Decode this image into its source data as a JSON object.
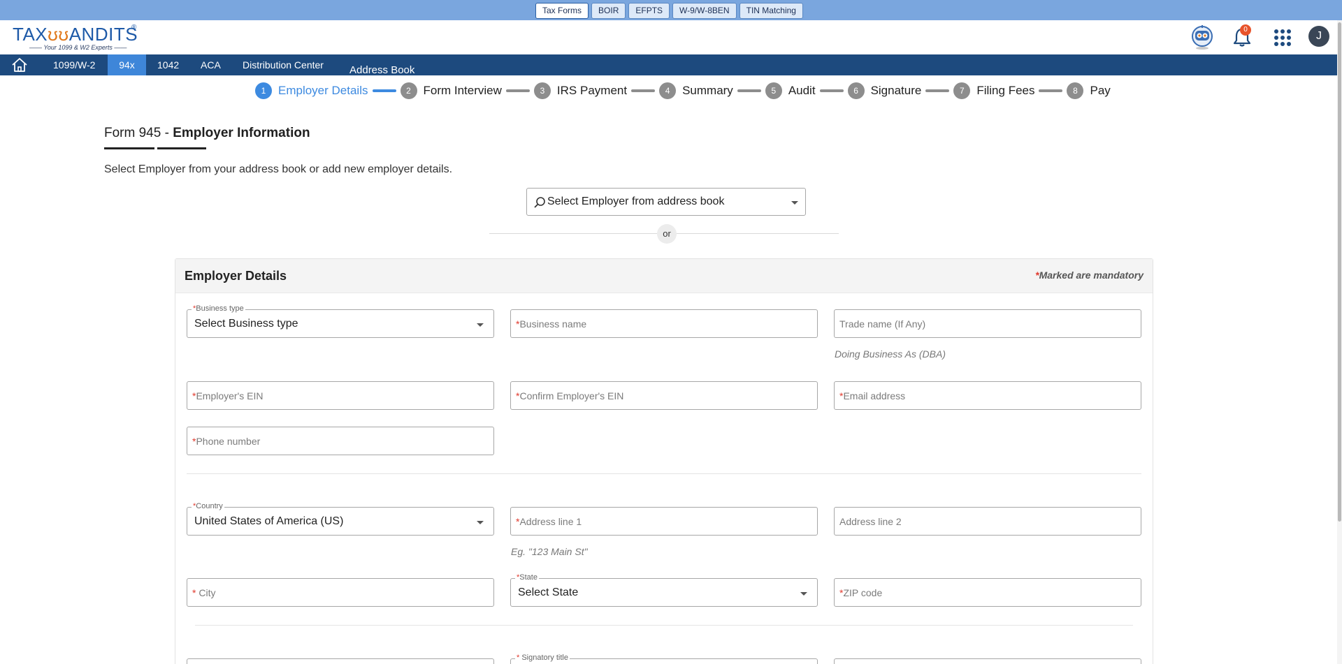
{
  "top_tabs": [
    "Tax Forms",
    "BOIR",
    "EFPTS",
    "W-9/W-8BEN",
    "TIN Matching"
  ],
  "logo": {
    "text_pre": "TAX",
    "text_post": "ANDITS",
    "tagline": "Your 1099 & W2 Experts",
    "reg": "®"
  },
  "header": {
    "notification_count": "0",
    "avatar_initial": "J"
  },
  "nav": {
    "items": [
      "1099/W-2",
      "94x",
      "1042",
      "ACA",
      "Distribution Center"
    ],
    "address_book": "Address Book"
  },
  "stepper": [
    {
      "num": "1",
      "label": "Employer Details"
    },
    {
      "num": "2",
      "label": "Form Interview"
    },
    {
      "num": "3",
      "label": "IRS Payment"
    },
    {
      "num": "4",
      "label": "Summary"
    },
    {
      "num": "5",
      "label": "Audit"
    },
    {
      "num": "6",
      "label": "Signature"
    },
    {
      "num": "7",
      "label": "Filing Fees"
    },
    {
      "num": "8",
      "label": "Pay"
    }
  ],
  "page": {
    "form_no": "Form 945 - ",
    "title": "Employer Information",
    "instructions": "Select Employer from your address book or add new employer details.",
    "employer_select": "Select Employer from address book",
    "or": "or"
  },
  "card": {
    "title": "Employer Details",
    "mandatory_star": "*",
    "mandatory_text": "Marked are mandatory",
    "business_type_label": "Business type",
    "business_type_value": "Select Business type",
    "business_name": "Business name",
    "trade_name": "Trade name (If Any)",
    "dba_hint": "Doing Business As (DBA)",
    "ein": "Employer's EIN",
    "confirm_ein": "Confirm Employer's EIN",
    "email": "Email address",
    "phone": "Phone number",
    "country_label": "Country",
    "country_value": "United States of America (US)",
    "address1": "Address line 1",
    "address1_hint": "Eg. \"123 Main St\"",
    "address2": "Address line 2",
    "city": " City",
    "state_label": "State",
    "state_value": "Select State",
    "zip": "ZIP code",
    "signatory_title_label": " Signatory title"
  }
}
